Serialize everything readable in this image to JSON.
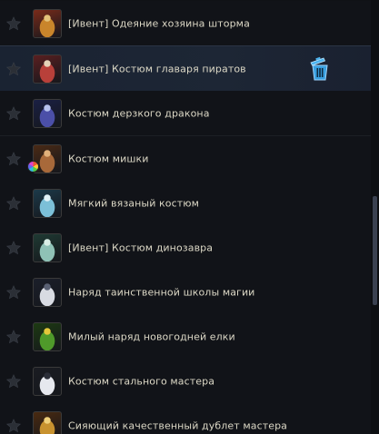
{
  "costumes": [
    {
      "label": "[Ивент] Одеяние хозяина шторма",
      "icon": "storm-master-costume-icon",
      "colors": [
        "#7a2b1a",
        "#c9852b",
        "#e3c27a"
      ]
    },
    {
      "label": "[Ивент] Костюм главаря пиратов",
      "icon": "pirate-chief-costume-icon",
      "colors": [
        "#5a1f20",
        "#b8403a",
        "#e6d3b8"
      ],
      "selected": true,
      "trash": "trash-icon"
    },
    {
      "label": "Костюм дерзкого дракона",
      "icon": "bold-dragon-costume-icon",
      "colors": [
        "#1a2044",
        "#4b4fa8",
        "#b6c2ee"
      ]
    },
    {
      "label": "Костюм мишки",
      "icon": "bear-costume-icon",
      "colors": [
        "#4a2a15",
        "#a8693a",
        "#e1b07a"
      ],
      "rainbow": true
    },
    {
      "label": "Мягкий вязаный костюм",
      "icon": "knit-costume-icon",
      "colors": [
        "#1c3a4a",
        "#7cc0d8",
        "#e2f2f7"
      ]
    },
    {
      "label": "[Ивент] Костюм динозавра",
      "icon": "dinosaur-costume-icon",
      "colors": [
        "#1f3a33",
        "#8fc2b6",
        "#d9efe6"
      ]
    },
    {
      "label": "Наряд таинственной школы магии",
      "icon": "magic-school-outfit-icon",
      "colors": [
        "#1b1f2a",
        "#d8dbe2",
        "#5a6174"
      ]
    },
    {
      "label": "Милый наряд новогодней елки",
      "icon": "christmas-tree-outfit-icon",
      "colors": [
        "#1d3a12",
        "#4f9a2a",
        "#e3c83a"
      ]
    },
    {
      "label": "Костюм стального мастера",
      "icon": "steel-master-costume-icon",
      "colors": [
        "#1a1c22",
        "#e6e8ee",
        "#2b2e38"
      ]
    },
    {
      "label": "Сияющий качественный дублет мастера",
      "icon": "master-doublet-icon",
      "colors": [
        "#4a2a10",
        "#c8922f",
        "#f0d07a"
      ]
    }
  ]
}
